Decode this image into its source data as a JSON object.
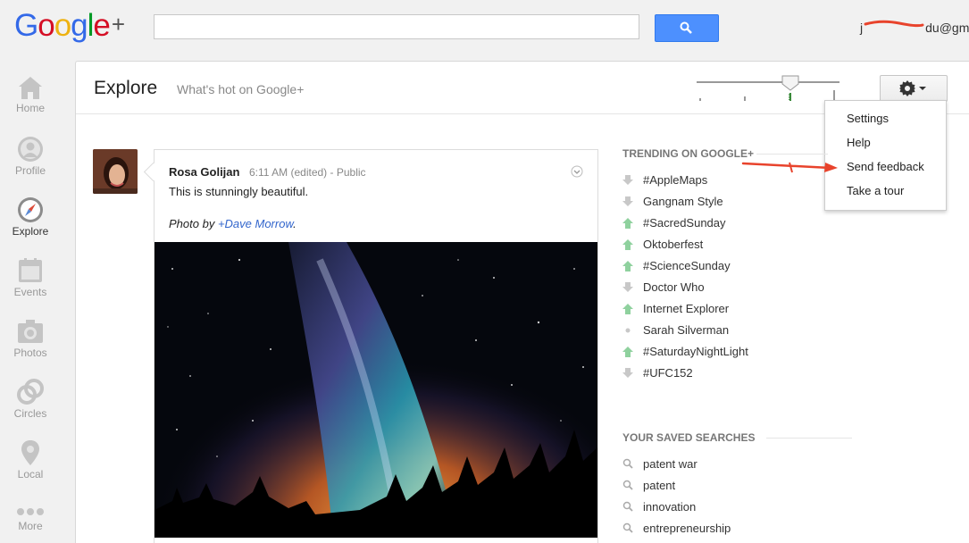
{
  "logo": {
    "text": "Google",
    "plus": "+"
  },
  "account": {
    "email_visible": "j",
    "email_suffix": "du@gmail"
  },
  "nav": [
    {
      "label": "Home",
      "icon": "home-icon"
    },
    {
      "label": "Profile",
      "icon": "profile-icon"
    },
    {
      "label": "Explore",
      "icon": "compass-icon",
      "active": true
    },
    {
      "label": "Events",
      "icon": "calendar-icon"
    },
    {
      "label": "Photos",
      "icon": "camera-icon"
    },
    {
      "label": "Circles",
      "icon": "circles-icon"
    },
    {
      "label": "Local",
      "icon": "map-pin-icon"
    },
    {
      "label": "More",
      "icon": "more-dots-icon"
    }
  ],
  "header": {
    "title": "Explore",
    "subtitle": "What's hot on Google+"
  },
  "menu": {
    "items": [
      "Settings",
      "Help",
      "Send feedback",
      "Take a tour"
    ]
  },
  "post": {
    "author": "Rosa Golijan",
    "time": "6:11 AM (edited)",
    "separator": " - ",
    "visibility": "Public",
    "text": "This is stunningly beautiful.",
    "credit_prefix": "Photo by ",
    "credit_plus": "+",
    "credit_name": "Dave Morrow",
    "credit_suffix": "."
  },
  "trending": {
    "title": "TRENDING ON GOOGLE+",
    "items": [
      {
        "label": "#AppleMaps",
        "direction": "down"
      },
      {
        "label": "Gangnam Style",
        "direction": "down"
      },
      {
        "label": "#SacredSunday",
        "direction": "up"
      },
      {
        "label": "Oktoberfest",
        "direction": "up"
      },
      {
        "label": "#ScienceSunday",
        "direction": "up"
      },
      {
        "label": "Doctor Who",
        "direction": "down"
      },
      {
        "label": "Internet Explorer",
        "direction": "up"
      },
      {
        "label": "Sarah Silverman",
        "direction": "same"
      },
      {
        "label": "#SaturdayNightLight",
        "direction": "up"
      },
      {
        "label": "#UFC152",
        "direction": "down"
      }
    ]
  },
  "saved_searches": {
    "title": "YOUR SAVED SEARCHES",
    "items": [
      "patent war",
      "patent",
      "innovation",
      "entrepreneurship"
    ]
  },
  "colors": {
    "accent_blue": "#4d90fe",
    "arrow_up": "#8fd19e",
    "arrow_down": "#c8c8c8",
    "annotation_red": "#e8432c"
  }
}
